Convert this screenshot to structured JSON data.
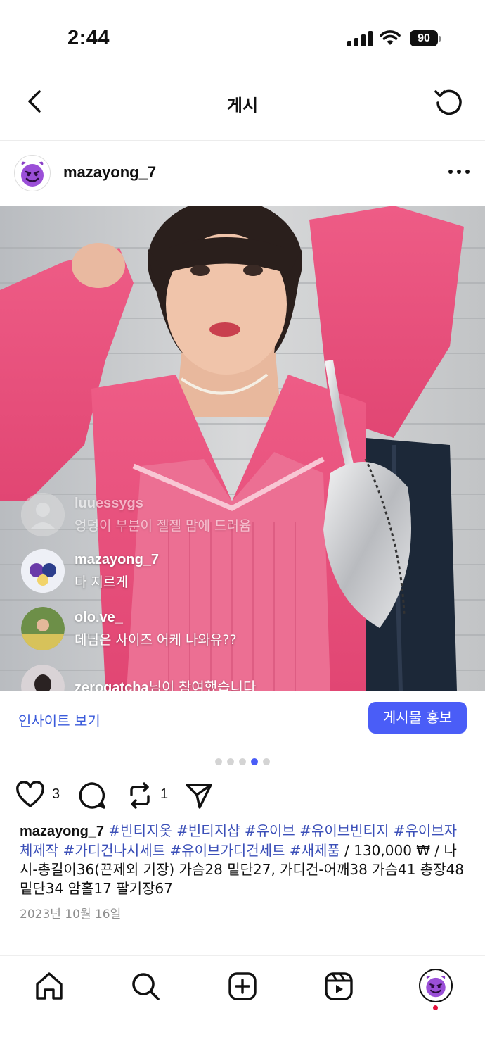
{
  "status_bar": {
    "time": "2:44",
    "battery": "90"
  },
  "header": {
    "title": "게시",
    "back_icon": "chevron-left-icon",
    "refresh_icon": "refresh-icon"
  },
  "post": {
    "username": "mazayong_7",
    "avatar_icon": "smiling-devil-icon",
    "more_icon": "more-horizontal-icon"
  },
  "live_comments": [
    {
      "user": "luuessygs",
      "text": "엉덩이 부분이 젤젤 맘에 드러윰"
    },
    {
      "user": "mazayong_7",
      "text": "다 지르게"
    },
    {
      "user": "olo.ve_",
      "text": "데님은 사이즈 어케 나와유??"
    },
    {
      "user": "zerogatcha",
      "text": "님이 참여했습니다"
    }
  ],
  "insights": {
    "link_label": "인사이트 보기",
    "promote_label": "게시물 홍보"
  },
  "carousel": {
    "count": 5,
    "active_index": 3
  },
  "actions": {
    "likes": "3",
    "reposts": "1"
  },
  "caption": {
    "username": "mazayong_7",
    "hashtags": [
      "#빈티지옷",
      "#빈티지샵",
      "#유이브",
      "#유이브빈티지",
      "#유이브자체제작",
      "#가디건나시세트",
      "#유이브가디건세트",
      "#새제품"
    ],
    "body": "/ 130,000 ₩ / 나시-총길이36(끈제외 기장) 가슴28 밑단27, 가디건-어깨38 가슴41 총장48 밑단34 암홀17 팔기장67",
    "date": "2023년 10월 16일"
  },
  "tab_bar": {
    "tabs": [
      "home-icon",
      "search-icon",
      "create-icon",
      "reels-icon",
      "profile-avatar"
    ]
  },
  "colors": {
    "accent": "#4a5df7",
    "hashtag": "#3b4fb8",
    "sweater_pink": "#e8547d"
  }
}
